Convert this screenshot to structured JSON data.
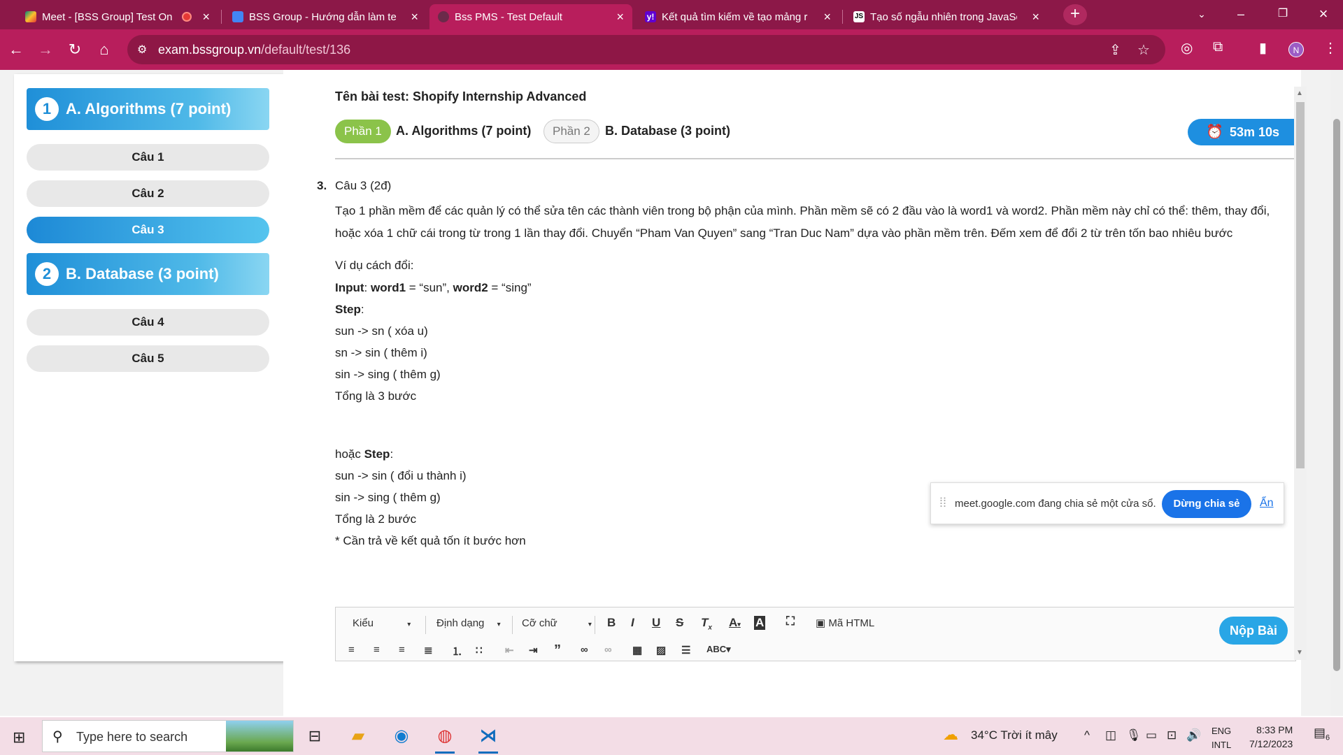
{
  "browser": {
    "tabs": [
      {
        "title": "Meet - [BSS Group] Test On",
        "active": false
      },
      {
        "title": "BSS Group - Hướng dẫn làm tes",
        "active": false
      },
      {
        "title": "Bss PMS - Test Default",
        "active": true
      },
      {
        "title": "Kết quả tìm kiếm về tạo mảng r",
        "active": false
      },
      {
        "title": "Tạo số ngẫu nhiên trong JavaSc",
        "active": false
      }
    ],
    "url_host": "exam.bssgroup.vn",
    "url_path": "/default/test/136",
    "profile_initial": "N"
  },
  "sidebar": {
    "sections": [
      {
        "num": "1",
        "label": "A. Algorithms (7 point)"
      },
      {
        "num": "2",
        "label": "B. Database (3 point)"
      }
    ],
    "questions": [
      "Câu 1",
      "Câu 2",
      "Câu 3",
      "Câu 4",
      "Câu 5"
    ]
  },
  "test": {
    "name": "Tên bài test: Shopify Internship Advanced",
    "parts": [
      {
        "pill": "Phần 1",
        "label": "A. Algorithms (7 point)"
      },
      {
        "pill": "Phần 2",
        "label": "B. Database (3 point)"
      }
    ],
    "timer": "53m 10s"
  },
  "question": {
    "number": "3.",
    "title": "Câu 3 (2đ)",
    "description": "Tạo 1 phần mềm để các quản lý có thể sửa tên các thành viên trong bộ phận của mình. Phần mềm sẽ có 2 đầu vào là word1 và word2. Phần mềm này chỉ có thể: thêm, thay đổi, hoặc xóa 1 chữ cái trong từ trong 1 lần thay đổi. Chuyển “Pham Van Quyen” sang “Tran Duc Nam” dựa vào phần mềm trên. Đếm xem để đổi 2 từ trên tốn bao nhiêu bước",
    "example_intro": "Ví dụ cách đổi:",
    "input_label": "Input",
    "input_w1_label": "word1",
    "input_w1_value": " = “sun”, ",
    "input_w2_label": "word2",
    "input_w2_value": " = “sing”",
    "step_label": "Step",
    "steps1": [
      "sun -> sn ( xóa u)",
      "sn -> sin ( thêm i)",
      "sin -> sing ( thêm g)",
      "Tổng là 3 bước"
    ],
    "or_prefix": "hoặc ",
    "steps2": [
      "sun -> sin ( đổi u thành i)",
      "sin -> sing ( thêm g)",
      "Tổng là 2 bước",
      "* Cần trả về kết quả tốn ít bước hơn"
    ]
  },
  "editor": {
    "style_dd": "Kiểu",
    "format_dd": "Định dạng",
    "size_dd": "Cỡ chữ",
    "html_btn": "Mã HTML",
    "submit": "Nộp Bài"
  },
  "share_banner": {
    "message": "meet.google.com đang chia sẻ một cửa sổ.",
    "stop": "Dừng chia sẻ",
    "hide": "Ẩn"
  },
  "taskbar": {
    "search_placeholder": "Type here to search",
    "weather": "34°C  Trời ít mây",
    "lang1": "ENG",
    "lang2": "INTL",
    "time": "8:33 PM",
    "date": "7/12/2023",
    "notif_count": "6"
  },
  "colors": {
    "chrome_tabbar": "#8c1848",
    "chrome_toolbar": "#b81e5c",
    "accent_blue": "#1e8fe0",
    "part_active": "#8bc34a"
  }
}
